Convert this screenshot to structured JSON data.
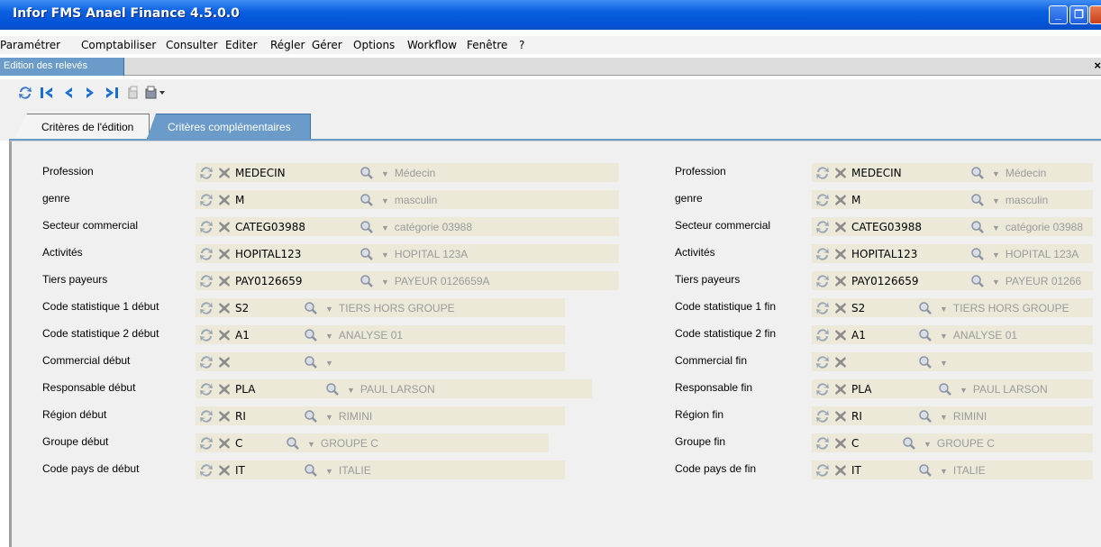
{
  "window": {
    "title": "Infor FMS Anael Finance 4.5.0.0"
  },
  "menu": [
    "Paramétrer",
    "Comptabiliser",
    "Consulter",
    "Editer",
    "Régler",
    "Gérer",
    "Options",
    "Workflow",
    "Fenêtre",
    "?"
  ],
  "doc_tab": {
    "label": "Edition des relevés",
    "close": "×"
  },
  "toolbar": [
    "refresh-icon",
    "first-record-icon",
    "previous-record-icon",
    "next-record-icon",
    "last-record-icon",
    "print-preview-icon",
    "print-icon",
    "dropdown-arrow-icon"
  ],
  "form_tabs": [
    {
      "label": "Critères de l'édition",
      "active": false
    },
    {
      "label": "Critères complémentaires",
      "active": true
    }
  ],
  "left_fields": [
    {
      "label": "Profession",
      "code": "MEDECIN",
      "desc": "Médecin"
    },
    {
      "label": "genre",
      "code": "M",
      "desc": "masculin"
    },
    {
      "label": "Secteur commercial",
      "code": "CATEG03988",
      "desc": "catégorie 03988"
    },
    {
      "label": "Activités",
      "code": "HOPITAL123",
      "desc": "HOPITAL 123A"
    },
    {
      "label": "Tiers payeurs",
      "code": "PAY0126659",
      "desc": "PAYEUR 0126659A"
    },
    {
      "label": "Code statistique 1 début",
      "code": "S2",
      "desc": "TIERS HORS GROUPE"
    },
    {
      "label": "Code statistique 2 début",
      "code": "A1",
      "desc": "ANALYSE 01"
    },
    {
      "label": "Commercial début",
      "code": "",
      "desc": ""
    },
    {
      "label": "Responsable début",
      "code": "PLA",
      "desc": "PAUL LARSON"
    },
    {
      "label": "Région début",
      "code": "RI",
      "desc": "RIMINI"
    },
    {
      "label": "Groupe début",
      "code": "C",
      "desc": "GROUPE C"
    },
    {
      "label": "Code pays de début",
      "code": "IT",
      "desc": "ITALIE"
    }
  ],
  "right_fields": [
    {
      "label": "Profession",
      "code": "MEDECIN",
      "desc": "Médecin"
    },
    {
      "label": "genre",
      "code": "M",
      "desc": "masculin"
    },
    {
      "label": "Secteur commercial",
      "code": "CATEG03988",
      "desc": "catégorie 03988"
    },
    {
      "label": "Activités",
      "code": "HOPITAL123",
      "desc": "HOPITAL 123A"
    },
    {
      "label": "Tiers payeurs",
      "code": "PAY0126659",
      "desc": "PAYEUR 01266"
    },
    {
      "label": "Code statistique 1 fin",
      "code": "S2",
      "desc": "TIERS HORS GROUPE"
    },
    {
      "label": "Code statistique 2 fin",
      "code": "A1",
      "desc": "ANALYSE 01"
    },
    {
      "label": "Commercial fin",
      "code": "",
      "desc": ""
    },
    {
      "label": "Responsable fin",
      "code": "PLA",
      "desc": "PAUL LARSON"
    },
    {
      "label": "Région fin",
      "code": "RI",
      "desc": "RIMINI"
    },
    {
      "label": "Groupe fin",
      "code": "C",
      "desc": "GROUPE C"
    },
    {
      "label": "Code pays de fin",
      "code": "IT",
      "desc": "ITALIE"
    }
  ],
  "colors": {
    "tab_active": "#6a9bc9",
    "field_bg": "#ece9d8",
    "title_bar": "#0a5fe0",
    "desc_text": "#9a9a9a"
  }
}
